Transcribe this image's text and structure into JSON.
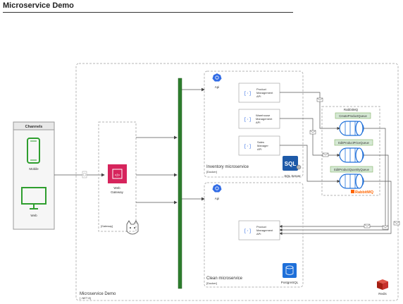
{
  "page": {
    "title": "Microservice Demo"
  },
  "channels": {
    "title": "Channels",
    "mobile_label": "Mobile",
    "web_label": "Web"
  },
  "gateway": {
    "label_line1": "Web",
    "label_line2": "Gateway",
    "container_label": "[Gateway]"
  },
  "outer": {
    "title": "Microservice Demo",
    "subtitle": "[ .NET 8]",
    "redis_label": "Redis"
  },
  "inventory": {
    "api_label": "Api",
    "title": "Inventory microservice",
    "subtitle": "[Docker]",
    "sql_label": "SQL Server",
    "services": [
      {
        "line1": "Product",
        "line2": "Management",
        "line3": "API"
      },
      {
        "line1": "Warehouse",
        "line2": "Management",
        "line3": "API"
      },
      {
        "line1": "Sales",
        "line2": "Manager",
        "line3": "API"
      }
    ]
  },
  "clean": {
    "api_label": "Api",
    "title": "Clean microservice",
    "subtitle": "[Docker]",
    "service": {
      "line1": "Product",
      "line2": "Management",
      "line3": "API"
    },
    "db_label": "PostgreSQL"
  },
  "rabbit": {
    "title": "RabbitMQ",
    "logo_text": "RabbitMQ",
    "queues": [
      "CreateProductQueue",
      "EditProductPriceQueue",
      "EditProductQuantityQueue"
    ]
  },
  "colors": {
    "bus": "#2d7d2d",
    "gateway": "#d6245c",
    "queue_label_border": "#82b366",
    "queue_label_fill": "#d5e8d4",
    "cylinder": "#1e6fd9",
    "rabbit": "#ff6600",
    "redis": "#c6302b",
    "k8s": "#326ce5",
    "channel_device": "#2e9e2e"
  }
}
